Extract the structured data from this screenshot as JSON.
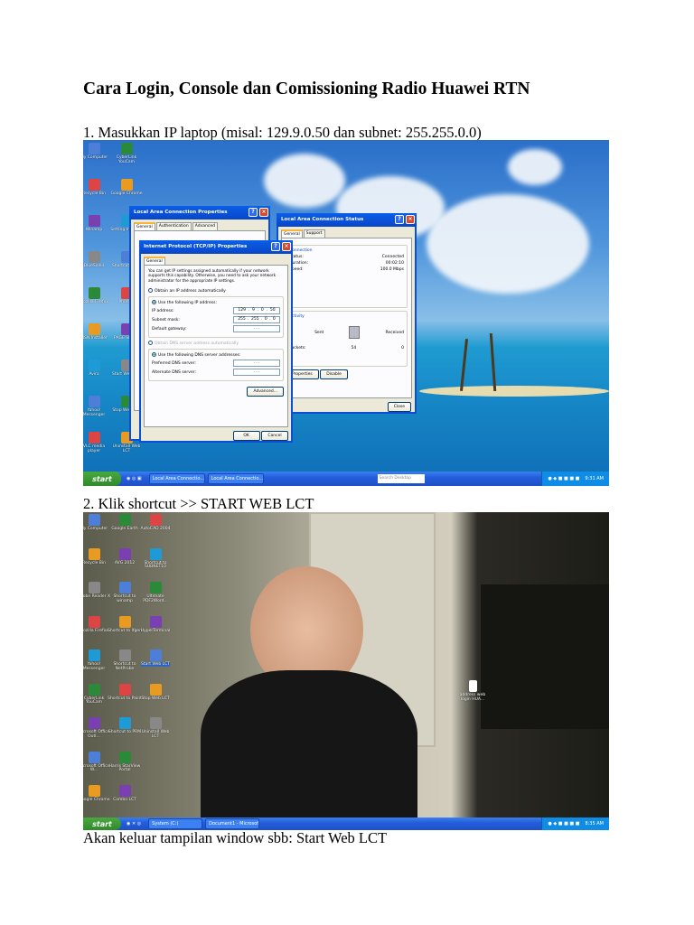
{
  "title": "Cara Login, Console dan Comissioning Radio Huawei RTN",
  "step1": "1. Masukkan IP laptop (misal: 129.9.0.50 dan subnet: 255.255.0.0)",
  "step2": "2. Klik shortcut >> START WEB LCT",
  "note": "Akan keluar tampilan window sbb: Start Web LCT",
  "shot1": {
    "icons": [
      "My Computer",
      "CyberLink YouCam",
      "Recycle Bin",
      "Google Chrome",
      "Winamp",
      "Setting Internet",
      "BlueSoleil",
      "Shortcut to PE",
      "Mozilla Firefox",
      "Photo...",
      "MSN Installer",
      "PAGE SPEED",
      "Avira",
      "Start Web LCT",
      "Yahoo! Messenger",
      "Stop Web LCT",
      "VLC media player",
      "Uninstall Web LCT"
    ],
    "props_dialog": {
      "title": "Local Area Connection Properties",
      "tabs": [
        "General",
        "Authentication",
        "Advanced"
      ]
    },
    "tcpip_dialog": {
      "title": "Internet Protocol (TCP/IP) Properties",
      "tab": "General",
      "intro": "You can get IP settings assigned automatically if your network supports this capability. Otherwise, you need to ask your network administrator for the appropriate IP settings.",
      "auto_ip": "Obtain an IP address automatically",
      "use_ip": "Use the following IP address:",
      "ip_label": "IP address:",
      "ip": [
        "129",
        "9",
        "0",
        "50"
      ],
      "mask_label": "Subnet mask:",
      "mask": [
        "255",
        "255",
        "0",
        "0"
      ],
      "gw_label": "Default gateway:",
      "auto_dns": "Obtain DNS server address automatically",
      "use_dns": "Use the following DNS server addresses:",
      "pref_dns": "Preferred DNS server:",
      "alt_dns": "Alternate DNS server:",
      "advanced": "Advanced...",
      "ok": "OK",
      "cancel": "Cancel"
    },
    "status_dialog": {
      "title": "Local Area Connection Status",
      "tabs": [
        "General",
        "Support"
      ],
      "conn_group": "Connection",
      "status_label": "Status:",
      "status": "Connected",
      "duration_label": "Duration:",
      "duration": "00:02:10",
      "speed_label": "Speed:",
      "speed": "100.0 Mbps",
      "activity_group": "Activity",
      "sent": "Sent",
      "received": "Received",
      "packets_label": "Packets:",
      "packets_sent": "54",
      "packets_received": "0",
      "properties": "Properties",
      "disable": "Disable",
      "close": "Close"
    },
    "taskbar": {
      "start": "start",
      "tasks": [
        "Local Area Connectio...",
        "Local Area Connectio..."
      ],
      "search": "Search Desktop",
      "clock": "9:31 AM"
    }
  },
  "shot2": {
    "icons": [
      "My Computer",
      "Google Earth",
      "AutoCAD 2004",
      "Recycle Bin",
      "AVG 2012",
      "Shortcut to SUBNET10",
      "Adobe Reader X",
      "Shortcut to winamp",
      "Ultimate PDF2Word...",
      "Mozilla Firefox",
      "Shortcut to lfgen",
      "HyperTerminal",
      "Yahoo! Messenger",
      "Shortcut to NetProbe",
      "Start Web LCT",
      "CyberLink YouCam",
      "Shortcut to Paint",
      "Stop Web LCT",
      "Microsoft Office Outl...",
      "Shortcut to PRM",
      "Uninstall Web LCT",
      "Microsoft Office W...",
      "Harris StarView Portal",
      "",
      "Google Chrome",
      "Combo LCT",
      ""
    ],
    "file_icon": "address web login HUA...",
    "taskbar": {
      "start": "start",
      "tasks": [
        "System (C:)",
        "Document1 - Microsof..."
      ],
      "clock": "8:35 AM"
    }
  }
}
